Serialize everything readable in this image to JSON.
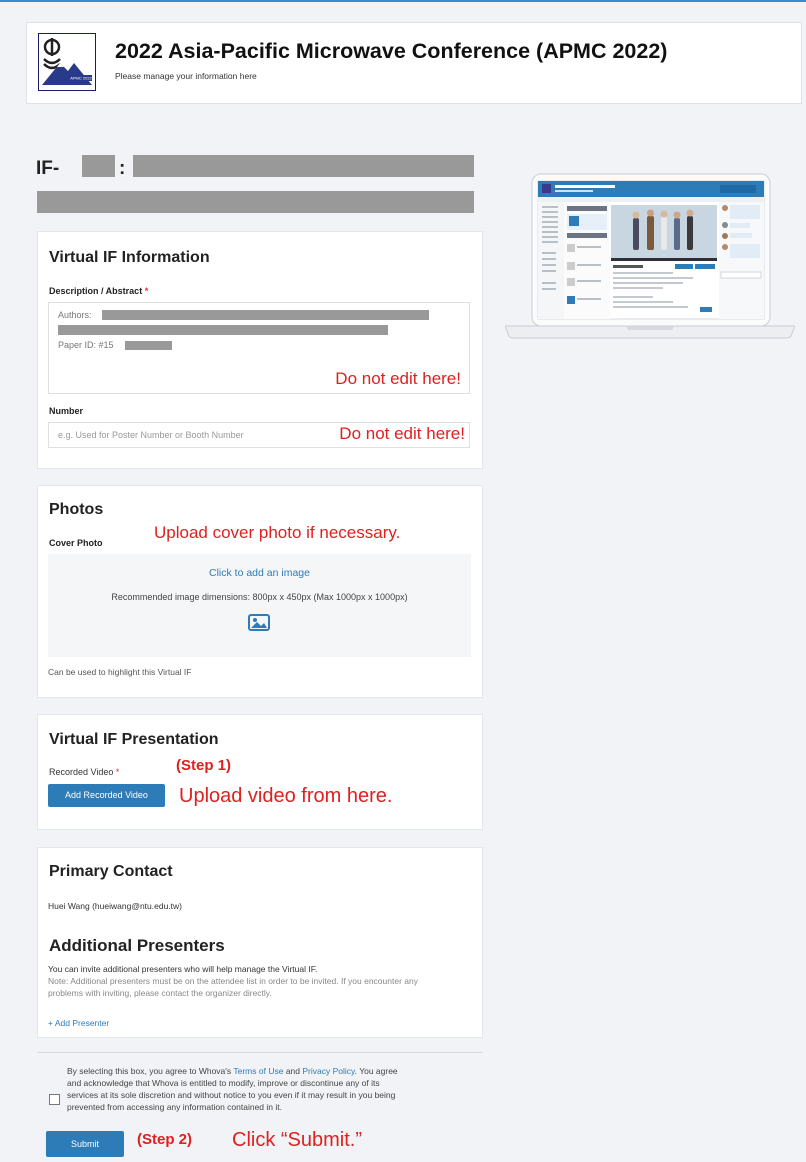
{
  "header": {
    "title": "2022 Asia-Pacific Microwave Conference (APMC 2022)",
    "subtitle": "Please manage your information here"
  },
  "page": {
    "title_prefix": "IF-",
    "title_sep": ":"
  },
  "info_card": {
    "title": "Virtual IF Information",
    "desc_label": "Description / Abstract",
    "required_mark": "*",
    "authors_prefix": "Authors:",
    "paper_id_prefix": "Paper ID: #15",
    "desc_note": "Do not edit here!",
    "number_label": "Number",
    "number_placeholder": "e.g. Used for Poster Number or Booth Number",
    "number_note": "Do not edit here!"
  },
  "photos_card": {
    "title": "Photos",
    "upload_note": "Upload cover photo if necessary.",
    "cover_label": "Cover Photo",
    "add_image_link": "Click to add an image",
    "dimensions_text": "Recommended image dimensions: 800px x 450px (Max 1000px x 1000px)",
    "help_text": "Can be used to highlight this Virtual IF"
  },
  "presentation_card": {
    "title": "Virtual IF Presentation",
    "video_label": "Recorded Video",
    "required_mark": "*",
    "step1": "(Step 1)",
    "add_video_button": "Add Recorded Video",
    "upload_note": "Upload video from here."
  },
  "contact_card": {
    "primary_title": "Primary Contact",
    "primary_contact": "Huei Wang (hueiwang@ntu.edu.tw)",
    "presenters_title": "Additional Presenters",
    "presenters_intro": "You can invite additional presenters who will help manage the Virtual IF.",
    "note_line1": "Note: Additional presenters must be on the attendee list in order to be invited. If you encounter any",
    "note_line2": "problems with inviting, please contact the organizer directly.",
    "add_presenter": "+ Add Presenter"
  },
  "terms": {
    "line1_a": "By selecting this box, you agree to Whova's ",
    "terms_link": "Terms of Use",
    "line1_b": " and ",
    "privacy_link": "Privacy Policy",
    "line1_c": ". You agree",
    "line2": "and acknowledge that Whova is entitled to modify, improve or discontinue any of its",
    "line3": "services at its sole discretion and without notice to you even if it may result in you being",
    "line4": "prevented from accessing any information contained in it.",
    "checked": false
  },
  "submit": {
    "button": "Submit",
    "step2": "(Step 2)",
    "note": "Click “Submit.”"
  },
  "colors": {
    "accent": "#2d7cb8",
    "annotation": "#e02020",
    "redaction": "#999999"
  }
}
